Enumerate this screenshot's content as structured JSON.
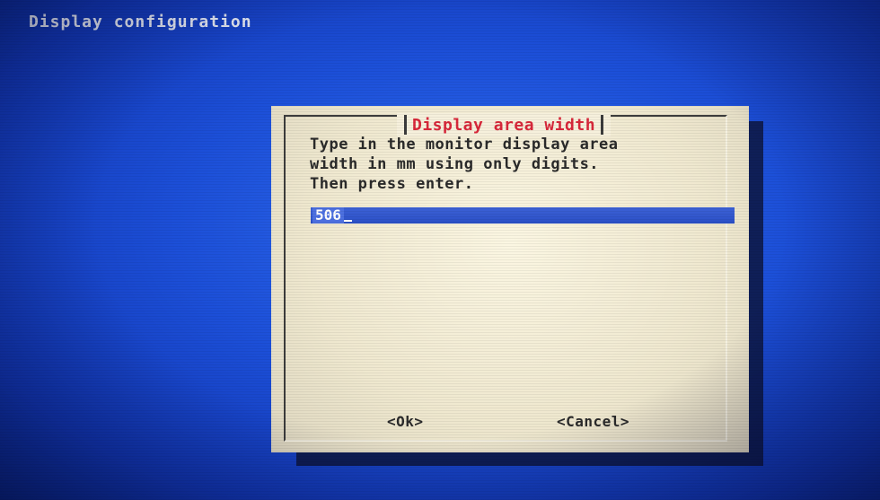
{
  "screen": {
    "backtitle": "Display configuration"
  },
  "dialog": {
    "title": "Display area width",
    "prompt": "Type in the monitor display area\nwidth in mm using only digits.\nThen press enter.",
    "input_value": "506",
    "ok_label": "<Ok>",
    "cancel_label": "<Cancel>"
  },
  "colors": {
    "background": "#1c4fd8",
    "dialog_bg": "#efe8cf",
    "title": "#d8283a",
    "input_bg": "#2a4fc6"
  }
}
